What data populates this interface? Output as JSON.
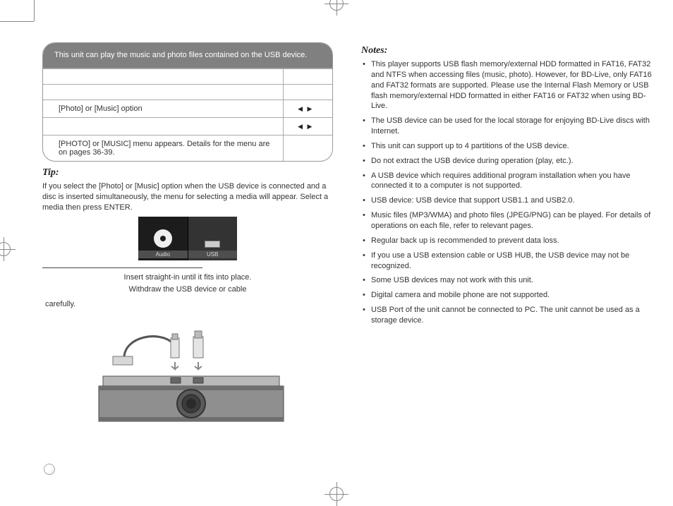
{
  "infobox": {
    "header": "This unit can play the music and photo files contained on the USB device.",
    "rows": [
      {
        "left": "",
        "right": ""
      },
      {
        "left": "",
        "right": ""
      },
      {
        "left": "[Photo] or [Music] option",
        "right_arrows": true
      },
      {
        "left": "",
        "right_arrows": true
      },
      {
        "left": "[PHOTO] or [MUSIC] menu appears. Details for the menu are on pages 36-39.",
        "right": ""
      }
    ]
  },
  "tip": {
    "heading": "Tip:",
    "body": "If you select the [Photo] or [Music] option when the USB device is connected and a disc is inserted simultaneously, the menu for selecting a media will appear. Select a media then press ENTER."
  },
  "mini_shot": {
    "left_label": "Audio",
    "right_label": "USB"
  },
  "insert_line": "Insert straight-in until it fits into place.",
  "withdraw_line": "Withdraw the USB device or cable",
  "carefully": "carefully.",
  "notes": {
    "heading": "Notes:",
    "items": [
      "This player supports USB flash memory/external HDD formatted in FAT16, FAT32 and NTFS when accessing files (music, photo). However, for BD-Live, only FAT16 and FAT32 formats are supported. Please use the Internal Flash Memory or USB flash memory/external HDD formatted in either FAT16 or FAT32 when using BD-Live.",
      "The USB device can be used for the local storage for enjoying BD-Live discs with Internet.",
      "This unit can support up to 4 partitions of the USB device.",
      "Do not extract the USB device during operation (play, etc.).",
      "A USB device which requires additional program installation when you have connected it to a computer is not supported.",
      "USB device: USB device that support USB1.1 and USB2.0.",
      "Music files (MP3/WMA) and photo files (JPEG/PNG) can be played. For details of operations on each file, refer to relevant pages.",
      "Regular back up is recommended to prevent data loss.",
      "If you use a USB extension cable or USB HUB, the USB device may not be recognized.",
      "Some USB devices may not work with this unit.",
      "Digital camera and mobile phone are not supported.",
      "USB Port of the unit cannot be connected to PC. The unit cannot be used as a storage device."
    ]
  }
}
